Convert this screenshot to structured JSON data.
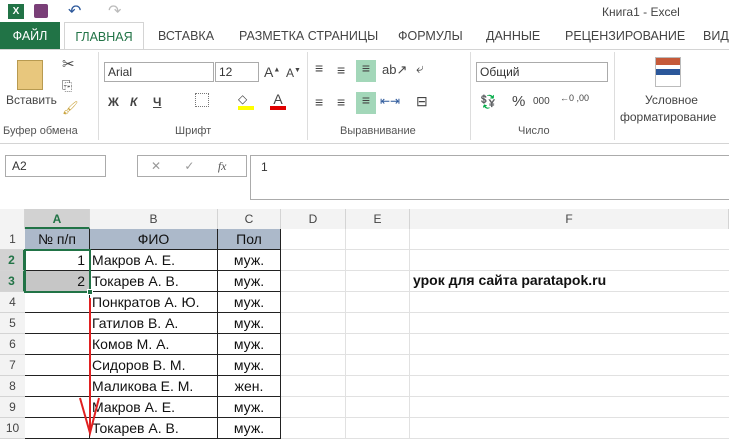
{
  "title": "Книга1 - Excel",
  "tabs": [
    "ФАЙЛ",
    "ГЛАВНАЯ",
    "ВСТАВКА",
    "РАЗМЕТКА СТРАНИЦЫ",
    "ФОРМУЛЫ",
    "ДАННЫЕ",
    "РЕЦЕНЗИРОВАНИЕ",
    "ВИД"
  ],
  "ribbon": {
    "paste": "Вставить",
    "font": "Arial",
    "size": "12",
    "bold": "Ж",
    "italic": "К",
    "underline": "Ч",
    "number_format": "Общий",
    "percent": "%",
    "thousands": "000",
    "cond_format_1": "Условное",
    "cond_format_2": "форматирование",
    "groups": [
      "Буфер обмена",
      "Шрифт",
      "Выравнивание",
      "Число"
    ]
  },
  "formula_bar": {
    "name_box": "A2",
    "fx": "fx",
    "value": "1"
  },
  "columns": [
    "A",
    "B",
    "C",
    "D",
    "E",
    "F"
  ],
  "rows": [
    "1",
    "2",
    "3",
    "4",
    "5",
    "6",
    "7",
    "8",
    "9",
    "10"
  ],
  "table": {
    "headers": [
      "№ п/п",
      "ФИО",
      "Пол"
    ],
    "data": [
      [
        "1",
        "Макров А. Е.",
        "муж."
      ],
      [
        "2",
        "Токарев А. В.",
        "муж."
      ],
      [
        "",
        "Понкратов А. Ю.",
        "муж."
      ],
      [
        "",
        "Гатилов В. А.",
        "муж."
      ],
      [
        "",
        "Комов М. А.",
        "муж."
      ],
      [
        "",
        "Сидоров В. М.",
        "муж."
      ],
      [
        "",
        "Маликова Е. М.",
        "жен."
      ],
      [
        "",
        "Макров А. Е.",
        "муж."
      ],
      [
        "",
        "Токарев А. В.",
        "муж."
      ]
    ]
  },
  "note": "урок для сайта paratapok.ru",
  "colors": {
    "accent": "#217346",
    "header_fill": "#acb9ca",
    "arrow": "#e02020"
  }
}
